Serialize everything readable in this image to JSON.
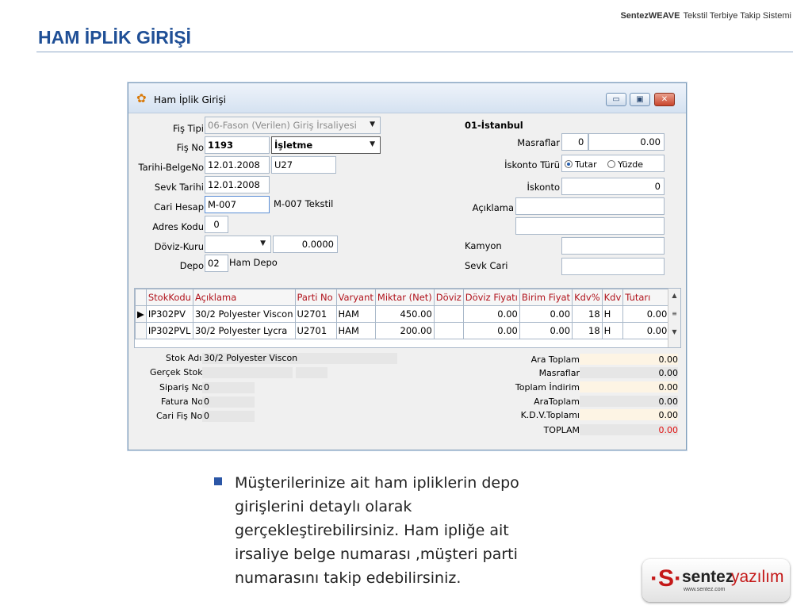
{
  "slide": {
    "brand_bold": "SentezWEAVE",
    "brand_rest": "Tekstil Terbiye Takip Sistemi",
    "title": "HAM İPLİK GİRİŞİ"
  },
  "window": {
    "title": "Ham İplik Girişi",
    "minimize": "▭",
    "maximize": "▣",
    "close": "✕"
  },
  "form": {
    "fis_tipi_label": "Fiş Tipi",
    "fis_tipi_value": "06-Fason (Verilen) Giriş İrsaliyesi",
    "fis_no_label": "Fiş No",
    "fis_no_value": "1193",
    "isletme_value": "İşletme",
    "tarih_belge_label": "Tarihi-BelgeNo",
    "tarih_value": "12.01.2008",
    "belge_no_value": "U27",
    "sevk_tarihi_label": "Sevk Tarihi",
    "sevk_tarihi_value": "12.01.2008",
    "cari_hesap_label": "Cari Hesap",
    "cari_hesap_value": "M-007",
    "cari_hesap_name": "M-007 Tekstil",
    "adres_kodu_label": "Adres Kodu",
    "adres_kodu_value": "0",
    "doviz_kuru_label": "Döviz-Kuru",
    "doviz_value": "",
    "kur_value": "0.0000",
    "depo_label": "Depo",
    "depo_value": "02",
    "depo_name": "Ham Depo",
    "location": "01-İstanbul",
    "masraflar_label": "Masraflar",
    "masraflar_count": "0",
    "masraflar_amount": "0.00",
    "iskonto_turu_label": "İskonto Türü",
    "tutar_label": "Tutar",
    "yuzde_label": "Yüzde",
    "iskonto_label": "İskonto",
    "iskonto_value": "0",
    "aciklama_label": "Açıklama",
    "kamyon_label": "Kamyon",
    "sevk_cari_label": "Sevk Cari"
  },
  "grid": {
    "columns": [
      "StokKodu",
      "Açıklama",
      "Parti No",
      "Varyant",
      "Miktar (Net)",
      "Döviz",
      "Döviz Fiyatı",
      "Birim Fiyat",
      "Kdv%",
      "Kdv",
      "Tutarı"
    ],
    "rows": [
      [
        "IP302PV",
        "30/2 Polyester Viscon",
        "U2701",
        "HAM",
        "450.00",
        "",
        "0.00",
        "0.00",
        "18",
        "H",
        "0.00"
      ],
      [
        "IP302PVL",
        "30/2 Polyester Lycra",
        "U2701",
        "HAM",
        "200.00",
        "",
        "0.00",
        "0.00",
        "18",
        "H",
        "0.00"
      ]
    ]
  },
  "info": {
    "stok_adi_label": "Stok Adı",
    "stok_adi_value": "30/2 Polyester Viscon",
    "gercek_stok_label": "Gerçek Stok",
    "siparis_no_label": "Sipariş No",
    "siparis_no_value": "0",
    "fatura_no_label": "Fatura No",
    "fatura_no_value": "0",
    "cari_fis_no_label": "Cari Fiş No",
    "cari_fis_no_value": "0"
  },
  "totals": [
    {
      "label": "Ara Toplam",
      "value": "0.00"
    },
    {
      "label": "Masraflar",
      "value": "0.00"
    },
    {
      "label": "Toplam İndirim",
      "value": "0.00"
    },
    {
      "label": "AraToplam",
      "value": "0.00"
    },
    {
      "label": "K.D.V.Toplamı",
      "value": "0.00"
    },
    {
      "label": "TOPLAM",
      "value": "0.00"
    }
  ],
  "bullet": "Müşterilerinize ait ham ipliklerin depo girişlerini detaylı olarak gerçekleştirebilirsiniz. Ham ipliğe ait irsaliye belge numarası ,müşteri parti numarasını takip edebilirsiniz.",
  "logo": {
    "mark": "·S·",
    "word1": "sentez",
    "word2": "yazılım",
    "url": "www.sentez.com"
  },
  "colors": {
    "title_blue": "#1f4f96",
    "grid_header_red": "#b0121b",
    "total_red": "#e01010"
  }
}
